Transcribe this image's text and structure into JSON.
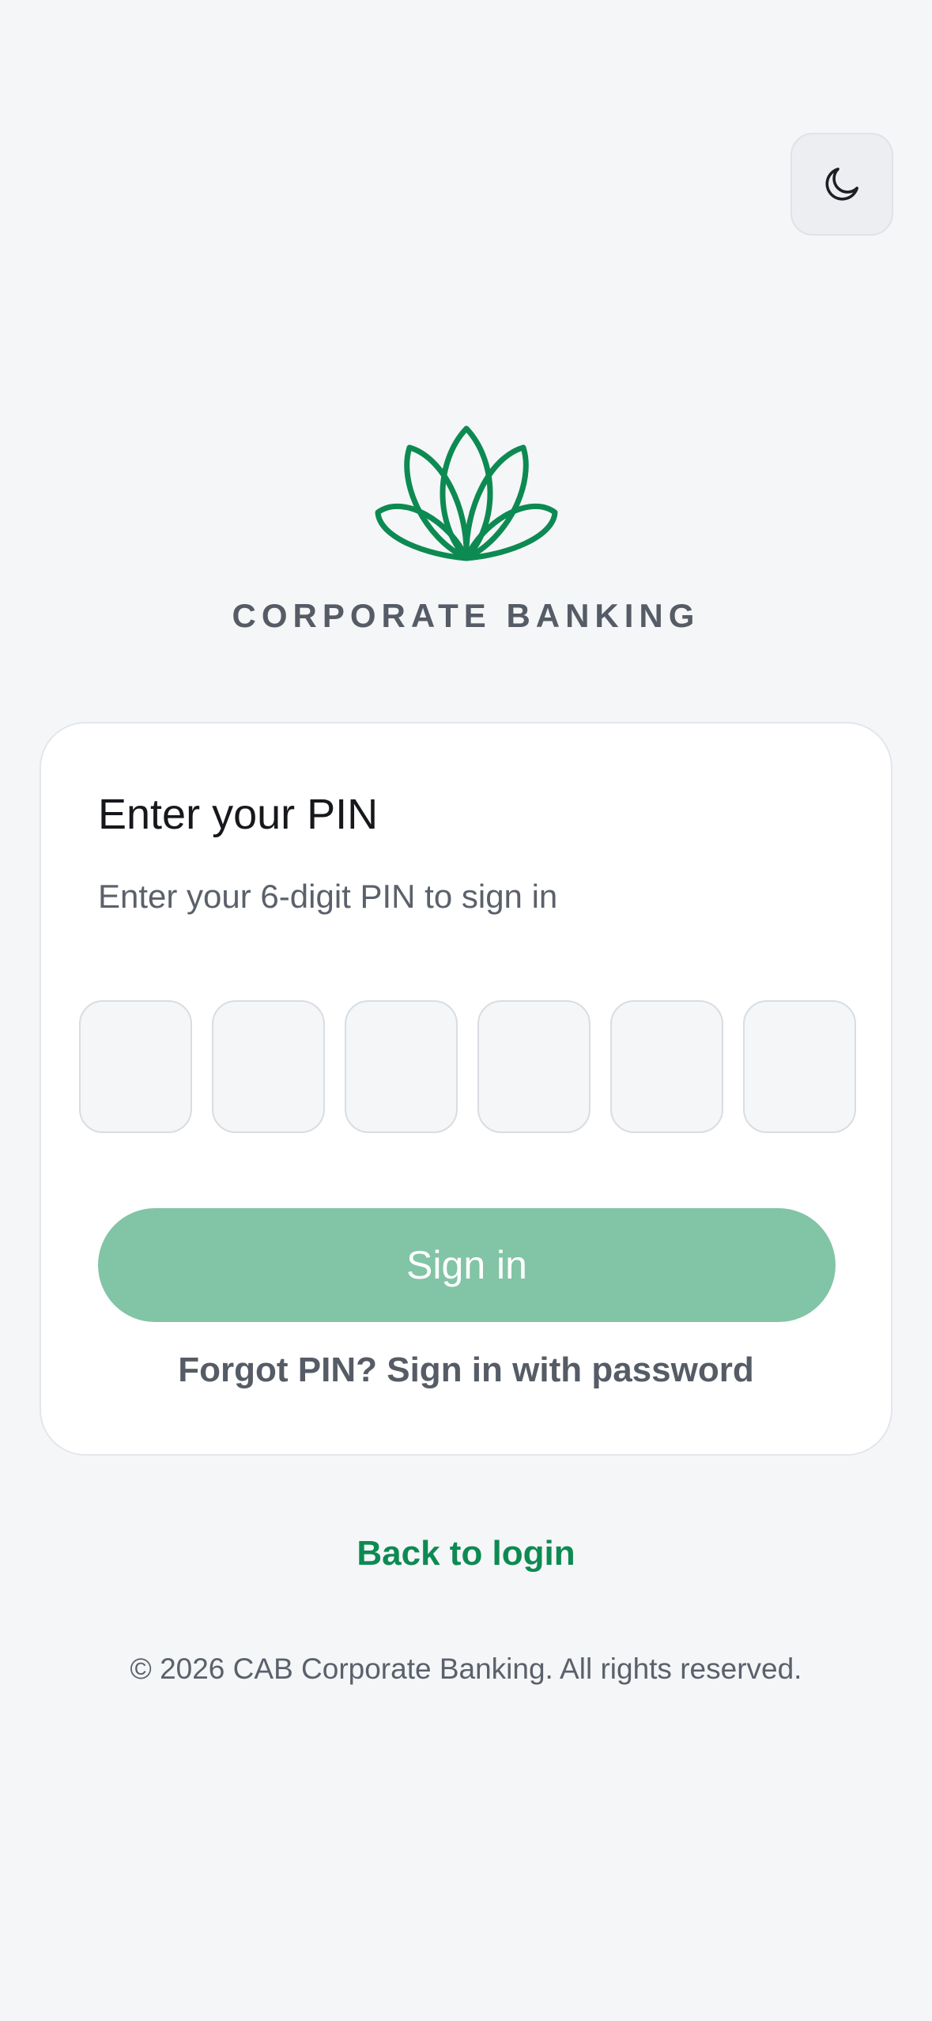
{
  "header": {
    "theme_toggle_icon": "moon-icon"
  },
  "brand": {
    "logo_icon": "lotus-logo-icon",
    "name": "CORPORATE BANKING",
    "accent_color": "#0d8a52"
  },
  "pin_card": {
    "title": "Enter your PIN",
    "subtitle": "Enter your 6-digit PIN to sign in",
    "digits": [
      "",
      "",
      "",
      "",
      "",
      ""
    ],
    "sign_in_label": "Sign in",
    "sign_in_color": "#82c4a6",
    "forgot_label": "Forgot PIN? Sign in with password"
  },
  "links": {
    "back_to_login": "Back to login"
  },
  "footer": {
    "copyright": "© 2026 CAB Corporate Banking. All rights reserved."
  }
}
